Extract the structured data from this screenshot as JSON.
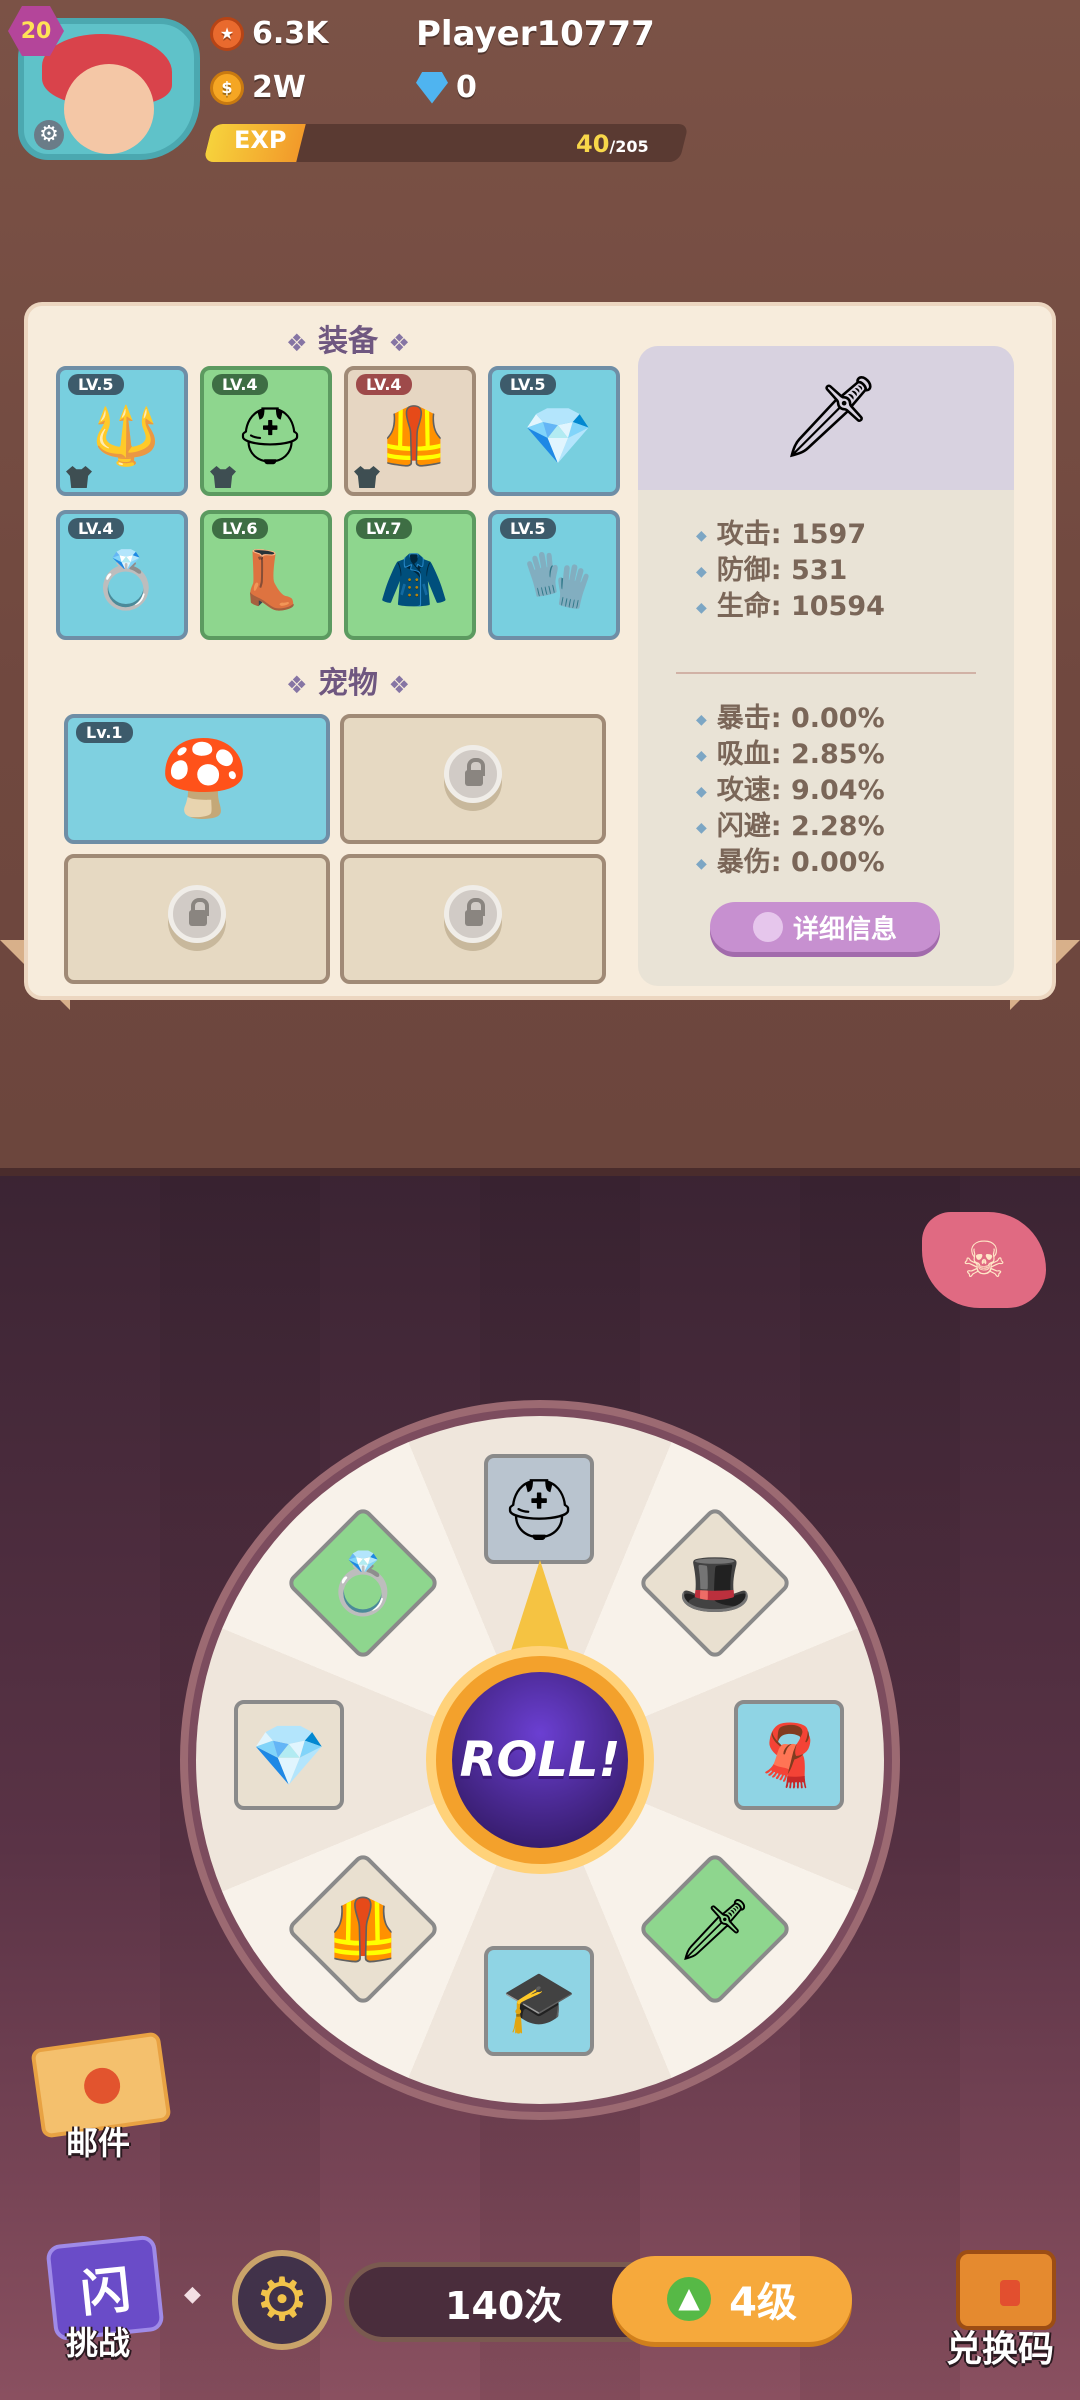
{
  "player": {
    "level": "20",
    "name": "Player10777",
    "power": "6.3K",
    "gold": "2W",
    "gems": "0"
  },
  "exp": {
    "label": "EXP",
    "current": "40",
    "max": "/205",
    "fill": 0.195
  },
  "sections": {
    "equipment_title": "装备",
    "pets_title": "宠物"
  },
  "equipment": [
    {
      "level": "LV.5",
      "icon": "staff-icon",
      "glyph": "🔱",
      "color": "blue",
      "equipped": true
    },
    {
      "level": "LV.4",
      "icon": "horned-helmet-icon",
      "glyph": "⛑",
      "color": "green",
      "equipped": true
    },
    {
      "level": "LV.4",
      "icon": "armor-icon",
      "glyph": "🦺",
      "color": "red",
      "equipped": true
    },
    {
      "level": "LV.5",
      "icon": "necklace-icon",
      "glyph": "💎",
      "color": "blue",
      "equipped": false
    },
    {
      "level": "LV.4",
      "icon": "ring-icon",
      "glyph": "💍",
      "color": "blue",
      "equipped": false
    },
    {
      "level": "LV.6",
      "icon": "boots-icon",
      "glyph": "👢",
      "color": "green",
      "equipped": false
    },
    {
      "level": "LV.7",
      "icon": "cloak-icon",
      "glyph": "🧥",
      "color": "green",
      "equipped": false
    },
    {
      "level": "LV.5",
      "icon": "gauntlet-icon",
      "glyph": "🧤",
      "color": "blue",
      "equipped": false
    }
  ],
  "pets": [
    {
      "level": "Lv.1",
      "icon": "mushroom-pet-icon",
      "glyph": "🍄",
      "locked": false
    },
    {
      "locked": true
    },
    {
      "locked": true
    },
    {
      "locked": true
    }
  ],
  "stats": {
    "attack": "攻击: 1597",
    "defense": "防御: 531",
    "hp": "生命: 10594",
    "crit": "暴击: 0.00%",
    "lifesteal": "吸血: 2.85%",
    "atk_speed": "攻速: 9.04%",
    "dodge": "闪避: 2.28%",
    "crit_damage": "暴伤: 0.00%",
    "detail_button": "详细信息"
  },
  "wheel": {
    "roll_label": "ROLL!",
    "items": [
      {
        "icon": "helmet-icon",
        "glyph": "⛑"
      },
      {
        "icon": "hat-icon",
        "glyph": "🎩"
      },
      {
        "icon": "cape-icon",
        "glyph": "🧣"
      },
      {
        "icon": "sword-icon",
        "glyph": "🗡"
      },
      {
        "icon": "wizard-hat-icon",
        "glyph": "🎓"
      },
      {
        "icon": "chest-armor-icon",
        "glyph": "🦺"
      },
      {
        "icon": "amulet-icon",
        "glyph": "💎"
      },
      {
        "icon": "ring-icon",
        "glyph": "💍"
      }
    ]
  },
  "bottom": {
    "mail": "邮件",
    "challenge": "挑战",
    "challenge_glyph": "闪",
    "spins": "140次",
    "upgrade": "4级",
    "redeem": "兑换码"
  },
  "colors": {
    "accent": "#f6a93c",
    "panel": "#f7ecdc",
    "purple_button": "#c790d0"
  }
}
